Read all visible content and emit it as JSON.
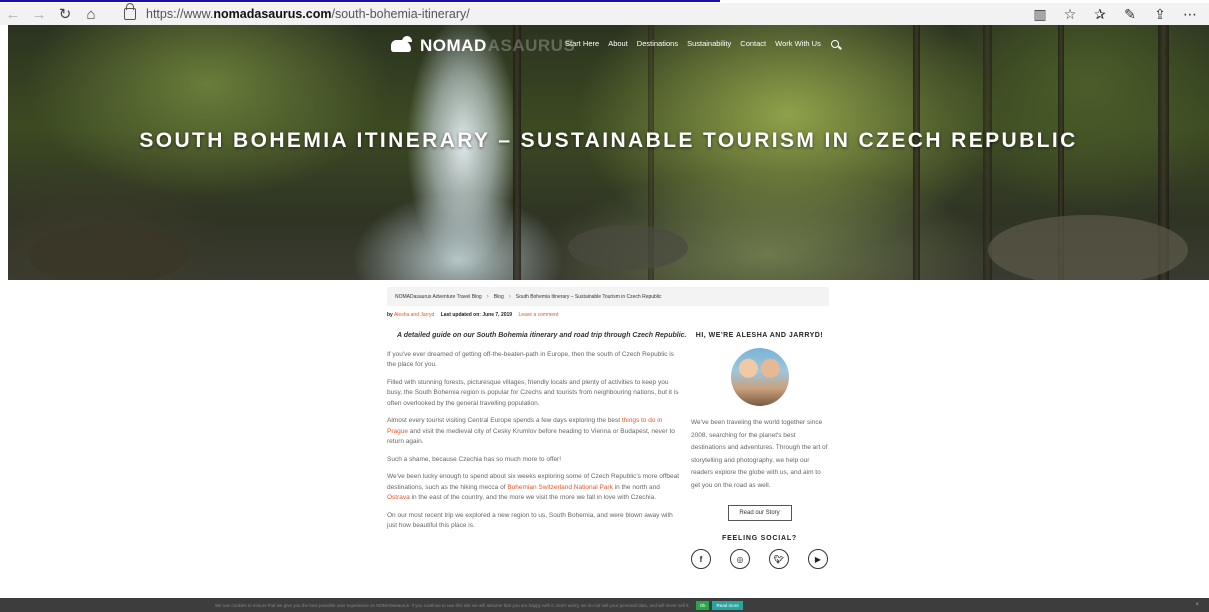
{
  "browser": {
    "url_prefix": "https://www.",
    "url_host": "nomadasaurus.com",
    "url_path": "/south-bohemia-itinerary/",
    "icons": [
      "back-icon",
      "forward-icon",
      "refresh-icon",
      "home-icon",
      "lock-icon",
      "reading-view-icon",
      "favorite-icon",
      "favorites-bar-icon",
      "pen-icon",
      "share-icon",
      "more-icon"
    ]
  },
  "site": {
    "logo_text": "NOMAD",
    "logo_faded": "ASAURUS",
    "nav": [
      "Start Here",
      "About",
      "Destinations",
      "Sustainability",
      "Contact",
      "Work With Us"
    ],
    "hero_title": "SOUTH BOHEMIA ITINERARY – SUSTAINABLE TOURISM IN CZECH REPUBLIC"
  },
  "breadcrumb": [
    "NOMADasaurus Adventure Travel Blog",
    "Blog",
    "South Bohemia Itinerary – Sustainable Tourism in Czech Republic"
  ],
  "byline": {
    "by": "by",
    "authors": "Alesha and Jarryd",
    "updated": "Last updated on: June 7, 2019",
    "comment": "Leave a comment"
  },
  "article": {
    "lead": "A detailed guide on our South Bohemia itinerary and road trip through Czech Republic.",
    "p1": "If you've ever dreamed of getting off-the-beaten-path in Europe, then the south of Czech Republic is the place for you.",
    "p2": "Filled with stunning forests, picturesque villages, friendly locals and plenty of activities to keep you busy, the South Bohemia region is popular for Czechs and tourists from neighbouring nations, but it is often overlooked by the general travelling population.",
    "p3_a": "Almost every tourist visiting Central Europe spends a few days exploring the best ",
    "p3_link": "things to do in Prague",
    "p3_b": " and visit the medieval city of Cesky Krumlov before heading to Vienna or Budapest, never to return again.",
    "p4": "Such a shame, because Czechia has so much more to offer!",
    "p5_a": "We've been lucky enough to spend about six weeks exploring some of Czech Republic's more offbeat destinations, such as the hiking mecca of ",
    "p5_link1": "Bohemian Switzerland National Park",
    "p5_b": " in the north and ",
    "p5_link2": "Ostrava",
    "p5_c": " in the east of the country, and the more we visit the more we fall in love with Czechia.",
    "p6": "On our most recent trip we explored a new region to us, South Bohemia, and were blown away with just how beautiful this place is."
  },
  "sidebar": {
    "title": "HI, WE'RE ALESHA AND JARRYD!",
    "bio": "We've been traveling the world together since 2008, searching for the planet's best destinations and adventures. Through the art of storytelling and photography, we help our readers explore the globe with us, and aim to get you on the road as well.",
    "button": "Read our Story",
    "social_title": "FEELING SOCIAL?",
    "social_icons": [
      "facebook-icon",
      "instagram-icon",
      "twitter-icon",
      "youtube-icon"
    ]
  },
  "cookie": {
    "text": "We use cookies to ensure that we give you the best possible user experience on NOMADasaurus. If you continue to use this site we will assume that you are happy with it. Don't worry, we do not sell your personal data, and will never sell it.",
    "ok": "Ok",
    "more": "Read more"
  }
}
